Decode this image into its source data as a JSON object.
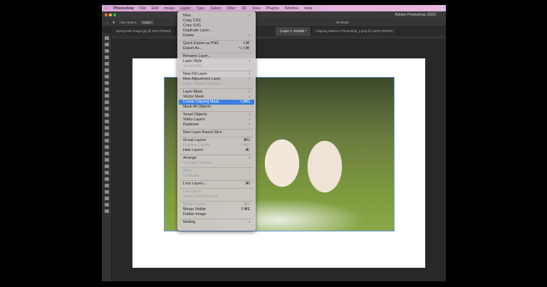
{
  "menubar": {
    "app": "Photoshop",
    "items": [
      "File",
      "Edit",
      "Image",
      "Layer",
      "Type",
      "Select",
      "Filter",
      "3D",
      "View",
      "Plugins",
      "Window",
      "Help"
    ],
    "active": "Layer"
  },
  "window_title": "Adobe Photoshop 2022",
  "options": {
    "auto_select": "Auto-Select:",
    "layer": "Layer",
    "mode3d": "3D Mode:"
  },
  "tabs": [
    {
      "label": "Spring Mini Image.jpg @ 50% (RGB/8)",
      "active": false
    },
    {
      "label": "(Layer 1, RGB/8) *",
      "active": true
    },
    {
      "label": "Clipping Masks in Photoshop_2.png @ 100% (RGB/8*)",
      "active": false
    }
  ],
  "layer_menu": [
    [
      {
        "label": "New",
        "sub": true
      },
      {
        "label": "Copy CSS"
      },
      {
        "label": "Copy SVG"
      },
      {
        "label": "Duplicate Layer..."
      },
      {
        "label": "Delete",
        "sub": true
      }
    ],
    [
      {
        "label": "Quick Export as PNG",
        "shortcut": "⇧⌘'"
      },
      {
        "label": "Export As...",
        "shortcut": "⌥⇧⌘'"
      }
    ],
    [
      {
        "label": "Rename Layer..."
      },
      {
        "label": "Layer Style",
        "sub": true
      },
      {
        "label": "Smart Filter",
        "disabled": true,
        "sub": true
      }
    ],
    [
      {
        "label": "New Fill Layer",
        "sub": true
      },
      {
        "label": "New Adjustment Layer",
        "sub": true
      },
      {
        "label": "Layer Content Options...",
        "disabled": true
      }
    ],
    [
      {
        "label": "Layer Mask",
        "sub": true
      },
      {
        "label": "Vector Mask",
        "sub": true
      },
      {
        "label": "Create Clipping Mask",
        "shortcut": "⌥⌘G",
        "highlighted": true
      },
      {
        "label": "Mask All Objects"
      }
    ],
    [
      {
        "label": "Smart Objects",
        "sub": true
      },
      {
        "label": "Video Layers",
        "sub": true
      },
      {
        "label": "Rasterize",
        "sub": true
      }
    ],
    [
      {
        "label": "New Layer Based Slice"
      }
    ],
    [
      {
        "label": "Group Layers",
        "shortcut": "⌘G"
      },
      {
        "label": "Ungroup Layers",
        "shortcut": "⇧⌘G",
        "disabled": true
      },
      {
        "label": "Hide Layers",
        "shortcut": "⌘,"
      }
    ],
    [
      {
        "label": "Arrange",
        "sub": true
      },
      {
        "label": "Combine Shapes",
        "disabled": true,
        "sub": true
      }
    ],
    [
      {
        "label": "Align",
        "disabled": true,
        "sub": true
      },
      {
        "label": "Distribute",
        "disabled": true,
        "sub": true
      }
    ],
    [
      {
        "label": "Lock Layers...",
        "shortcut": "⌘/"
      }
    ],
    [
      {
        "label": "Link Layers",
        "disabled": true
      },
      {
        "label": "Select Linked Layers",
        "disabled": true
      }
    ],
    [
      {
        "label": "Merge Layers",
        "shortcut": "⌘E",
        "disabled": true
      },
      {
        "label": "Merge Visible",
        "shortcut": "⇧⌘E"
      },
      {
        "label": "Flatten Image"
      }
    ],
    [
      {
        "label": "Matting",
        "sub": true
      }
    ]
  ],
  "colors": {
    "menubar": "#e0aedb",
    "highlight": "#3d7ee0"
  }
}
